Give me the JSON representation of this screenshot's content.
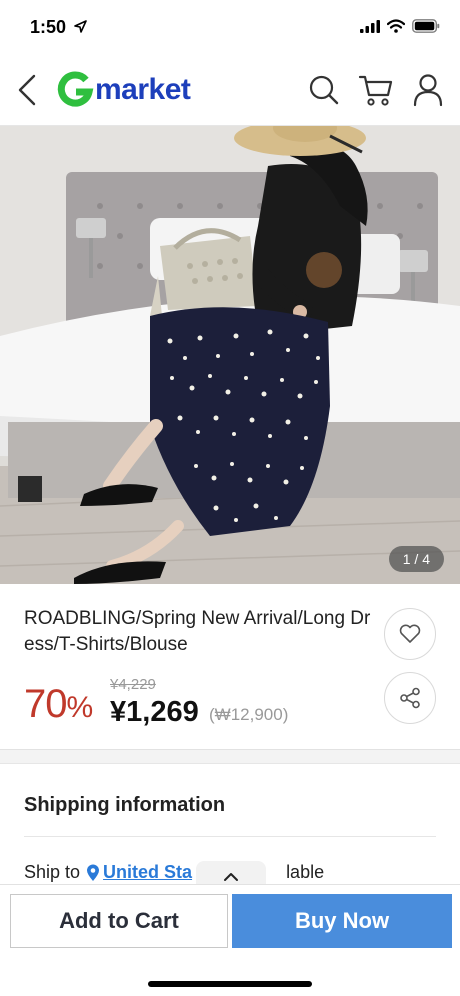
{
  "status": {
    "time": "1:50"
  },
  "header": {
    "logo_g": "G",
    "logo_text": "market"
  },
  "hero": {
    "counter": "1 / 4"
  },
  "product": {
    "title": "ROADBLING/Spring New Arrival/Long Dress/T-Shirts/Blouse",
    "discount_number": "70",
    "discount_symbol": "%",
    "original_price": "¥4,229",
    "sale_price": "¥1,269",
    "krw_price": "(₩12,900)"
  },
  "shipping": {
    "title": "Shipping information",
    "ship_to_label": "Ship to",
    "ship_to_link": "United Sta",
    "ship_to_suffix": "lable"
  },
  "bottom_bar": {
    "add_to_cart": "Add to Cart",
    "buy_now": "Buy Now"
  },
  "colors": {
    "brand_blue": "#1d3fbb",
    "brand_green": "#2fbf3f",
    "discount_red": "#c0392b",
    "buy_blue": "#4a8ddc",
    "link_blue": "#2a7ad8"
  }
}
